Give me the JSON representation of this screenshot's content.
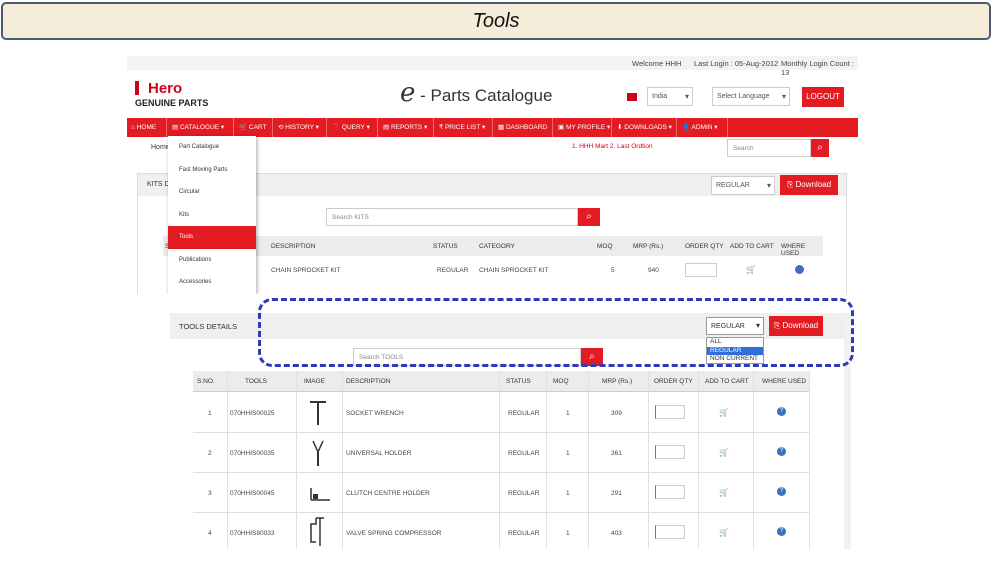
{
  "slide_title": "Tools",
  "header": {
    "welcome": "Welcome HHH",
    "last_login": "Last Login : 05-Aug-2012",
    "monthly_login": "Monthly Login Count : 13",
    "logo_name": "Hero",
    "logo_sub": "GENUINE PARTS",
    "catalogue_e": "e",
    "catalogue_title": "- Parts Catalogue",
    "country": "India",
    "language": "Select Language",
    "logout": "LOGOUT"
  },
  "nav": [
    {
      "label": "⌂ HOME"
    },
    {
      "label": "▤ CATALOGUE ▾"
    },
    {
      "label": "🛒 CART"
    },
    {
      "label": "⟲ HISTORY ▾"
    },
    {
      "label": "❓ QUERY ▾"
    },
    {
      "label": "▤ REPORTS ▾"
    },
    {
      "label": "₹ PRICE LIST ▾"
    },
    {
      "label": "▦ DASHBOARD"
    },
    {
      "label": "▣ MY PROFILE ▾"
    },
    {
      "label": "⬇ DOWNLOADS ▾"
    },
    {
      "label": "👤 ADMIN ▾"
    }
  ],
  "breadcrumb": "Home",
  "quick_links": "1. HHH Mart    2. Last Ordtion",
  "search_placeholder": "Search",
  "catalogue_menu": [
    "Part Catalogue",
    "Fast Moving Parts",
    "Circular",
    "Kits",
    "Tools",
    "Publications",
    "Accessories"
  ],
  "kits_panel": {
    "title": "KITS D",
    "filter": "REGULAR",
    "download": "Download",
    "search_placeholder": "Search KITS",
    "columns": [
      "S",
      "DESCRIPTION",
      "STATUS",
      "CATEGORY",
      "MOQ",
      "MRP (Rs.)",
      "ORDER QTY",
      "ADD TO CART",
      "WHERE USED"
    ],
    "row": {
      "description": "CHAIN SPROCKET KIT",
      "status": "REGULAR",
      "category": "CHAIN SPROCKET KIT",
      "moq": "5",
      "mrp": "940"
    }
  },
  "tools_panel": {
    "title": "TOOLS DETAILS",
    "filter": "REGULAR",
    "filter_options": [
      "ALL",
      "REGULAR",
      "NON CURRENT"
    ],
    "download": "Download",
    "search_placeholder": "Search TOOLS",
    "columns": [
      "S.NO.",
      "TOOLS",
      "IMAGE",
      "DESCRIPTION",
      "STATUS",
      "MOQ",
      "MRP (Rs.)",
      "ORDER QTY",
      "ADD TO CART",
      "WHERE USED"
    ],
    "rows": [
      {
        "sno": "1",
        "tool": "070HHIS00025",
        "description": "SOCKET WRENCH",
        "status": "REGULAR",
        "moq": "1",
        "mrp": "309"
      },
      {
        "sno": "2",
        "tool": "070HHIS00035",
        "description": "UNIVERSAL HOLDER",
        "status": "REGULAR",
        "moq": "1",
        "mrp": "361"
      },
      {
        "sno": "3",
        "tool": "070HHIS00045",
        "description": "CLUTCH CENTRE HOLDER",
        "status": "REGULAR",
        "moq": "1",
        "mrp": "291"
      },
      {
        "sno": "4",
        "tool": "070HHIS80033",
        "description": "VALVE SPRING COMPRESSOR",
        "status": "REGULAR",
        "moq": "1",
        "mrp": "403"
      }
    ]
  }
}
